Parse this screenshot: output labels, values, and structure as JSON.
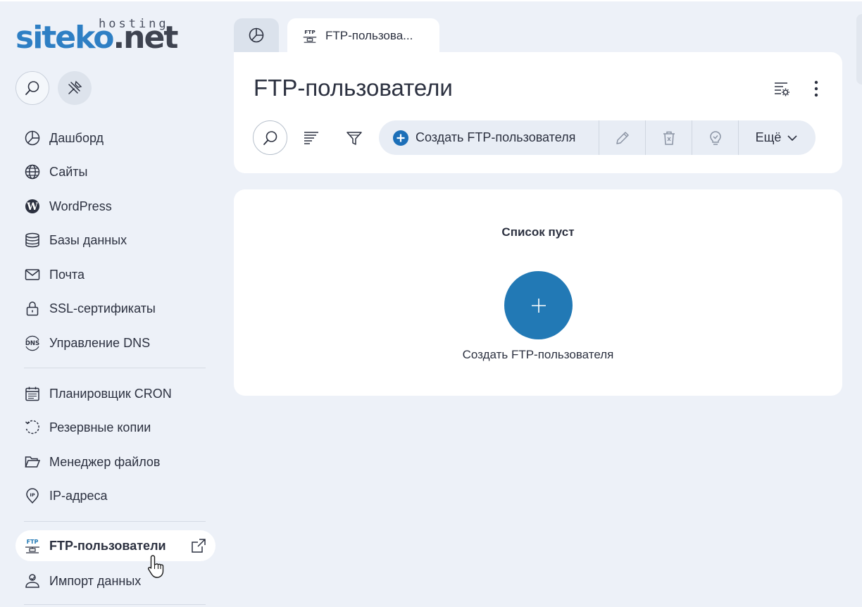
{
  "brand": {
    "logo_main_blue": "siteko",
    "logo_main_dark": ".net",
    "logo_sub": "hosting",
    "accent_color": "#2279b5",
    "logo_blue": "#2e7fc4"
  },
  "sidebar": {
    "search_button": "search-icon",
    "pin_button": "pin-icon",
    "items": [
      {
        "label": "Дашборд",
        "icon": "dashboard-icon"
      },
      {
        "label": "Сайты",
        "icon": "globe-icon"
      },
      {
        "label": "WordPress",
        "icon": "wordpress-icon"
      },
      {
        "label": "Базы данных",
        "icon": "database-icon"
      },
      {
        "label": "Почта",
        "icon": "mail-icon"
      },
      {
        "label": "SSL-сертификаты",
        "icon": "lock-icon"
      },
      {
        "label": "Управление DNS",
        "icon": "dns-icon"
      },
      {
        "label": "Планировщик CRON",
        "icon": "calendar-icon"
      },
      {
        "label": "Резервные копии",
        "icon": "backup-icon"
      },
      {
        "label": "Менеджер файлов",
        "icon": "folder-icon"
      },
      {
        "label": "IP-адреса",
        "icon": "ip-icon"
      },
      {
        "label": "FTP-пользователи",
        "icon": "ftp-icon",
        "active": true
      },
      {
        "label": "Импорт данных",
        "icon": "import-icon"
      }
    ]
  },
  "tabs": [
    {
      "label": "",
      "icon": "dashboard-icon"
    },
    {
      "label": "FTP-пользова...",
      "icon": "ftp-icon",
      "active": true
    }
  ],
  "header": {
    "title": "FTP-пользователи"
  },
  "toolbar": {
    "create_label": "Создать FTP-пользователя",
    "more_label": "Ещё"
  },
  "content": {
    "empty_title": "Список пуст",
    "create_caption": "Создать FTP-пользователя"
  }
}
